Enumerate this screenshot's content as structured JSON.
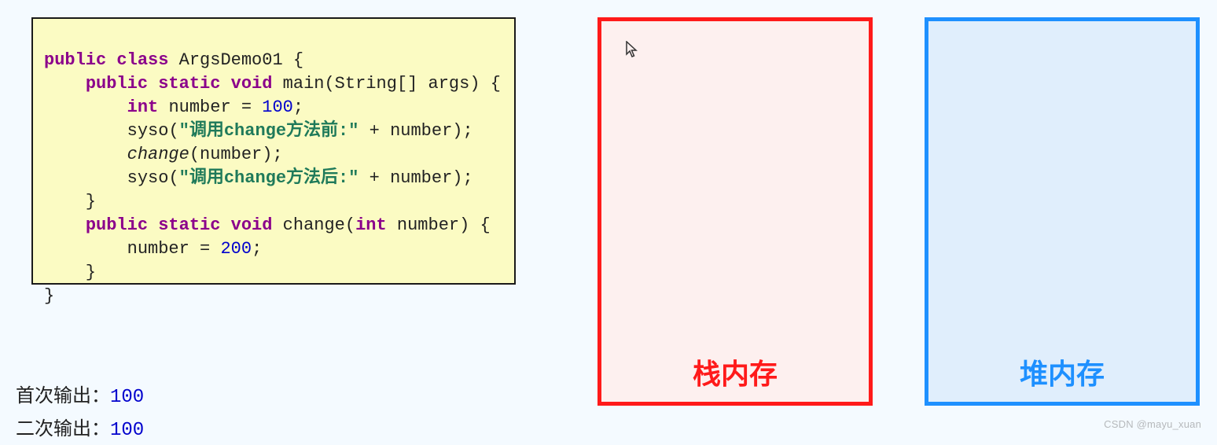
{
  "code": {
    "kw_public": "public",
    "kw_class": "class",
    "class_name": "ArgsDemo01",
    "kw_static": "static",
    "kw_void": "void",
    "method_main": "main",
    "main_params_pre": "(String[] args) {",
    "kw_int": "int",
    "var_number": "number",
    "assign100": " = ",
    "lit_100": "100",
    "semi": ";",
    "syso": "syso",
    "str_before": "\"调用change方法前:\"",
    "plus_number": " + number);",
    "call_change": "change",
    "change_arg": "(number);",
    "str_after": "\"调用change方法后:\"",
    "method_change": "change",
    "change_params_open": "(",
    "change_params_close": " number) {",
    "assign200_pre": "number = ",
    "lit_200": "200"
  },
  "memory": {
    "stack_label": "栈内存",
    "heap_label": "堆内存"
  },
  "output": {
    "line1_label": "首次输出：",
    "line1_value": "100",
    "line2_label": "二次输出：",
    "line2_value": "100"
  },
  "watermark": "CSDN @mayu_xuan"
}
